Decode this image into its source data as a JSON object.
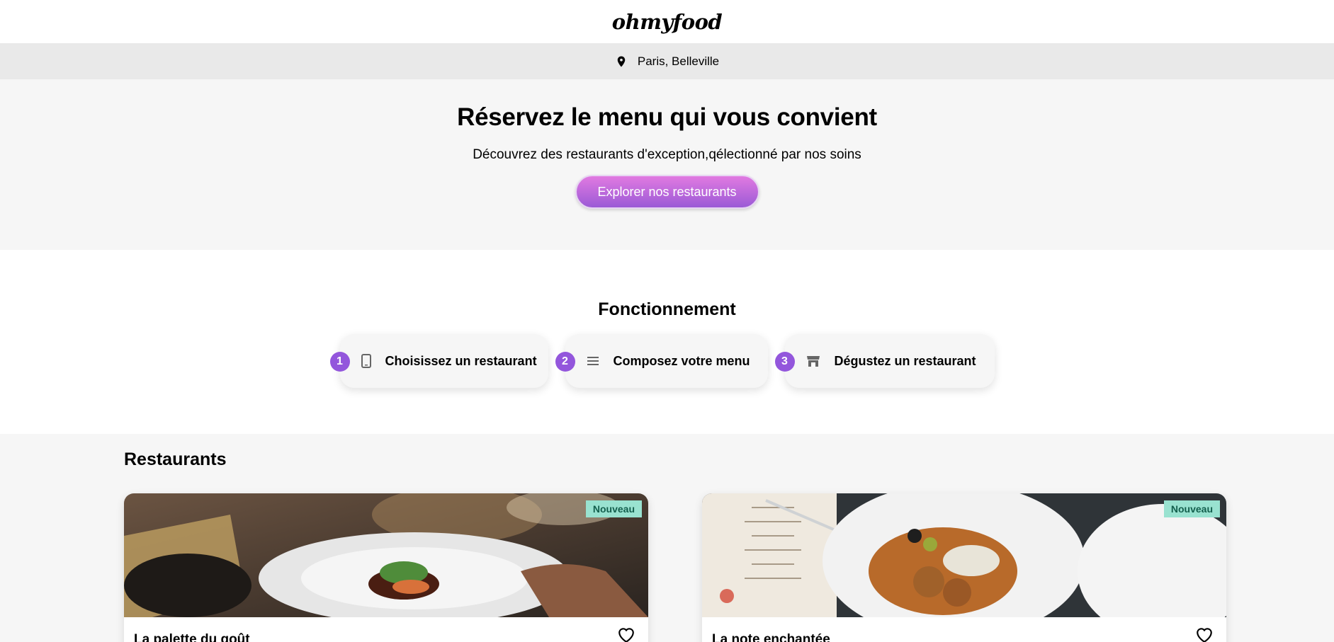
{
  "header": {
    "logo": "ohmyfood"
  },
  "location": {
    "icon": "map-pin-icon",
    "text": "Paris, Belleville"
  },
  "hero": {
    "title": "Réservez le menu qui vous convient",
    "subtitle": "Découvrez des restaurants d'exception,qélectionné par nos soins",
    "cta_label": "Explorer nos restaurants"
  },
  "how": {
    "title": "Fonctionnement",
    "steps": [
      {
        "number": "1",
        "icon": "phone-icon",
        "label": "Choisissez un restaurant"
      },
      {
        "number": "2",
        "icon": "list-icon",
        "label": "Composez votre menu"
      },
      {
        "number": "3",
        "icon": "store-icon",
        "label": "Dégustez un restaurant"
      }
    ]
  },
  "restaurants": {
    "title": "Restaurants",
    "items": [
      {
        "name": "La palette du goût",
        "badge": "Nouveau",
        "favorite_icon": "heart-icon"
      },
      {
        "name": "La note enchantée",
        "badge": "Nouveau",
        "favorite_icon": "heart-icon"
      }
    ]
  },
  "colors": {
    "accent_start": "#e17ae1",
    "accent_end": "#9b5ad6",
    "step_number": "#9356dc",
    "badge_bg": "#99e2d0",
    "badge_text": "#135f4d"
  }
}
